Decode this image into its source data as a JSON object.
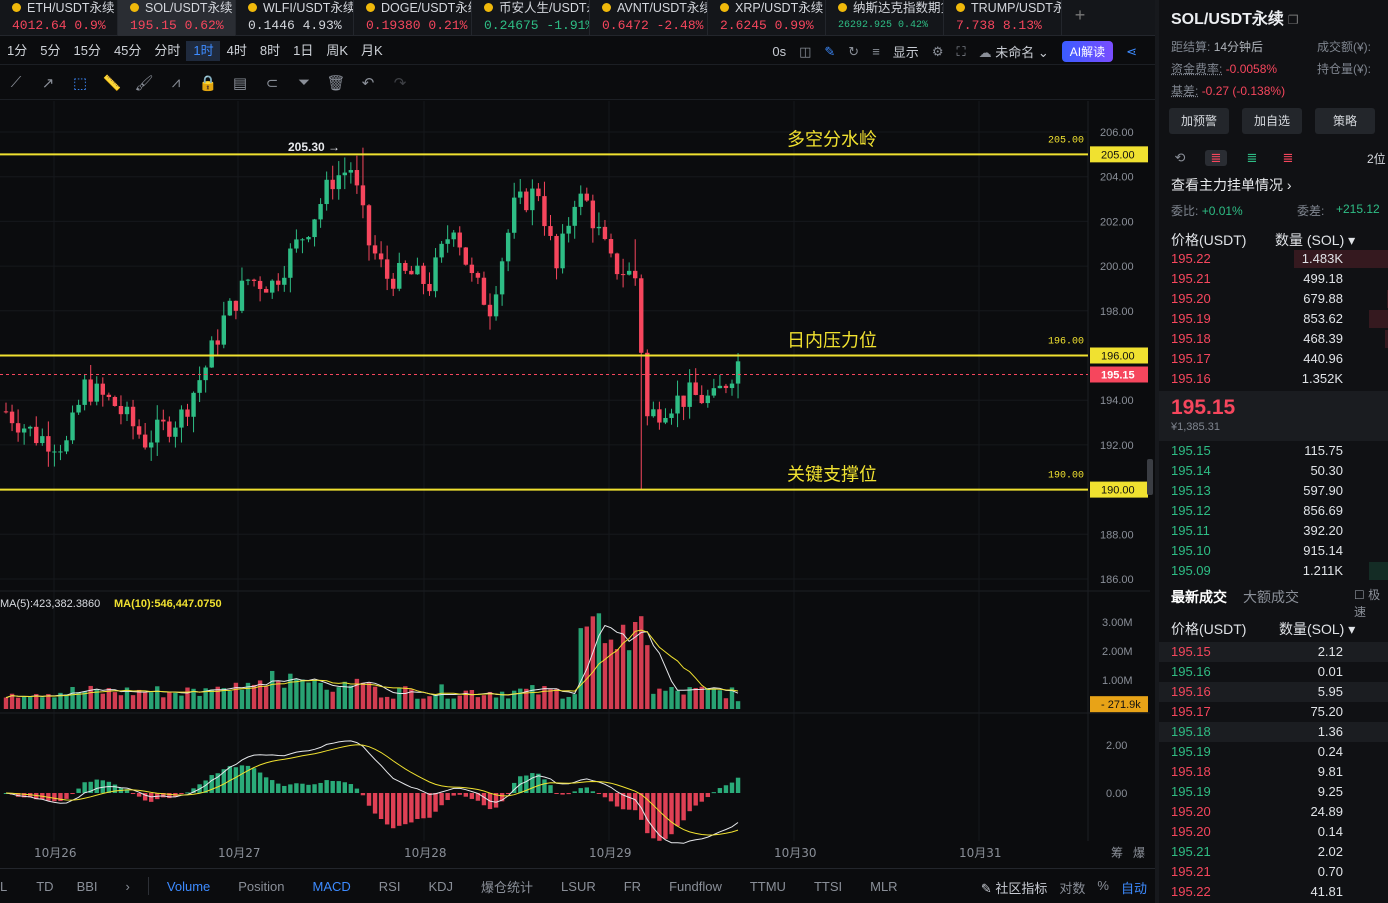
{
  "tickers": [
    {
      "name": "ETH/USDT永续",
      "price": "4012.64",
      "change": "0.9%",
      "dir": "down",
      "active": false
    },
    {
      "name": "SOL/USDT永续",
      "price": "195.15",
      "change": "0.62%",
      "dir": "down",
      "active": true
    },
    {
      "name": "WLFI/USDT永续",
      "price": "0.1446",
      "change": "4.93%",
      "dir": "neutral",
      "active": false
    },
    {
      "name": "DOGE/USDT永续",
      "price": "0.19380",
      "change": "0.21%",
      "dir": "down",
      "active": false
    },
    {
      "name": "币安人生/USDT永续",
      "price": "0.24675",
      "change": "-1.91%",
      "dir": "up",
      "active": false
    },
    {
      "name": "AVNT/USDT永续",
      "price": "0.6472",
      "change": "-2.48%",
      "dir": "down",
      "active": false
    },
    {
      "name": "XRP/USDT永续",
      "price": "2.6245",
      "change": "0.99%",
      "dir": "down",
      "active": false
    },
    {
      "name": "纳斯达克指数期货CFD",
      "price": "26292.925",
      "change": "0.42%",
      "dir": "up",
      "active": false,
      "small": true
    },
    {
      "name": "TRUMP/USDT永续",
      "price": "7.738",
      "change": "8.13%",
      "dir": "down",
      "active": false
    }
  ],
  "add_tab": "+",
  "intervals": [
    "1分",
    "5分",
    "15分",
    "45分",
    "分时",
    "1时",
    "4时",
    "8时",
    "1日",
    "周K",
    "月K"
  ],
  "active_interval": "1时",
  "toolbar": {
    "timer": "0s",
    "display": "显示",
    "layout_name": "未命名",
    "ai_label": "AI解读"
  },
  "indicators_left": [
    "L",
    "TD",
    "BBI"
  ],
  "indicators": [
    "Volume",
    "Position",
    "MACD",
    "RSI",
    "KDJ",
    "爆仓统计",
    "LSUR",
    "FR",
    "Fundflow",
    "TTMU",
    "TTSI",
    "MLR"
  ],
  "indicators_active": [
    "Volume",
    "MACD"
  ],
  "footer_right": {
    "community": "社区指标",
    "log": "对数",
    "pct": "%",
    "auto": "自动"
  },
  "chart_data": {
    "type": "candlestick",
    "symbol": "SOL/USDT永续",
    "interval": "1时",
    "price_axis": {
      "min": 186,
      "max": 206,
      "ticks": [
        "206.00",
        "204.00",
        "202.00",
        "200.00",
        "198.00",
        "196.00",
        "194.00",
        "192.00",
        "190.00",
        "188.00",
        "186.00"
      ]
    },
    "x_labels": [
      "10月26",
      "10月27",
      "10月28",
      "10月29",
      "10月30",
      "10月31"
    ],
    "current_price": "195.15",
    "high_marker": "205.30 →",
    "levels": [
      {
        "price": 205.0,
        "label": "多空分水岭",
        "price_text": "205.00",
        "color": "#f0e130"
      },
      {
        "price": 196.0,
        "label": "日内压力位",
        "price_text": "196.00",
        "color": "#f0e130"
      },
      {
        "price": 190.0,
        "label": "关键支撑位",
        "price_text": "190.00",
        "color": "#f0e130"
      }
    ],
    "volume": {
      "ma5_text": "MA(5):423,382.3860",
      "ma10_text": "MA(10):546,447.0750",
      "axis": [
        "3.00M",
        "2.00M",
        "1.00M"
      ],
      "last": "271.9k"
    },
    "macd": {
      "axis": [
        "2.00",
        "0.00"
      ]
    },
    "side_labels": [
      "筹",
      "爆"
    ]
  },
  "panel": {
    "symbol": "SOL/USDT永续",
    "settle_label": "距结算:",
    "settle_value": "14分钟后",
    "funding_label": "资金费率:",
    "funding_value": "-0.0058%",
    "basis_label": "基差:",
    "basis_value": "-0.27 (-0.138%)",
    "turnover_label": "成交额(¥):",
    "oi_label": "持仓量(¥):",
    "buttons": [
      "加预警",
      "加自选",
      "策略"
    ],
    "depth_label": "2位",
    "main_orders_link": "查看主力挂单情况 ›",
    "ratio_label": "委比:",
    "ratio_value": "+0.01%",
    "diff_label": "委差:",
    "diff_value": "+215.12",
    "ob_price_header": "价格(USDT)",
    "ob_qty_header": "数量 (SOL) ▾",
    "asks": [
      {
        "price": "195.22",
        "qty": "1.483K",
        "bar": 0.42
      },
      {
        "price": "195.21",
        "qty": "499.18",
        "bar": 0.0
      },
      {
        "price": "195.20",
        "qty": "679.88",
        "bar": 0.02
      },
      {
        "price": "195.19",
        "qty": "853.62",
        "bar": 0.1
      },
      {
        "price": "195.18",
        "qty": "468.39",
        "bar": 0.03
      },
      {
        "price": "195.17",
        "qty": "440.96",
        "bar": 0.0
      },
      {
        "price": "195.16",
        "qty": "1.352K",
        "bar": 0.0
      }
    ],
    "last_price": "195.15",
    "last_price_cny": "¥1,385.31",
    "bids": [
      {
        "price": "195.15",
        "qty": "115.75",
        "bar": 0.0
      },
      {
        "price": "195.14",
        "qty": "50.30",
        "bar": 0.0
      },
      {
        "price": "195.13",
        "qty": "597.90",
        "bar": 0.0
      },
      {
        "price": "195.12",
        "qty": "856.69",
        "bar": 0.0
      },
      {
        "price": "195.11",
        "qty": "392.20",
        "bar": 0.0
      },
      {
        "price": "195.10",
        "qty": "915.14",
        "bar": 0.0
      },
      {
        "price": "195.09",
        "qty": "1.211K",
        "bar": 0.1
      }
    ],
    "trade_tabs": [
      "最新成交",
      "大额成交"
    ],
    "trade_checkbox": "极速",
    "trade_price_header": "价格(USDT)",
    "trade_qty_header": "数量(SOL) ▾",
    "trades": [
      {
        "price": "195.15",
        "qty": "2.12",
        "dir": "down",
        "hl": true
      },
      {
        "price": "195.16",
        "qty": "0.01",
        "dir": "up",
        "hl": false
      },
      {
        "price": "195.16",
        "qty": "5.95",
        "dir": "down",
        "hl": true
      },
      {
        "price": "195.17",
        "qty": "75.20",
        "dir": "down",
        "hl": false
      },
      {
        "price": "195.18",
        "qty": "1.36",
        "dir": "up",
        "hl": true
      },
      {
        "price": "195.19",
        "qty": "0.24",
        "dir": "up",
        "hl": false
      },
      {
        "price": "195.18",
        "qty": "9.81",
        "dir": "down",
        "hl": false
      },
      {
        "price": "195.19",
        "qty": "9.25",
        "dir": "up",
        "hl": false
      },
      {
        "price": "195.20",
        "qty": "24.89",
        "dir": "down",
        "hl": false
      },
      {
        "price": "195.20",
        "qty": "0.14",
        "dir": "down",
        "hl": false
      },
      {
        "price": "195.21",
        "qty": "2.02",
        "dir": "up",
        "hl": false
      },
      {
        "price": "195.21",
        "qty": "0.70",
        "dir": "down",
        "hl": false
      },
      {
        "price": "195.22",
        "qty": "41.81",
        "dir": "down",
        "hl": false
      }
    ]
  },
  "colors": {
    "up": "#2ebd85",
    "down": "#f6465d",
    "level": "#f0e130",
    "accent": "#3d8bff"
  }
}
